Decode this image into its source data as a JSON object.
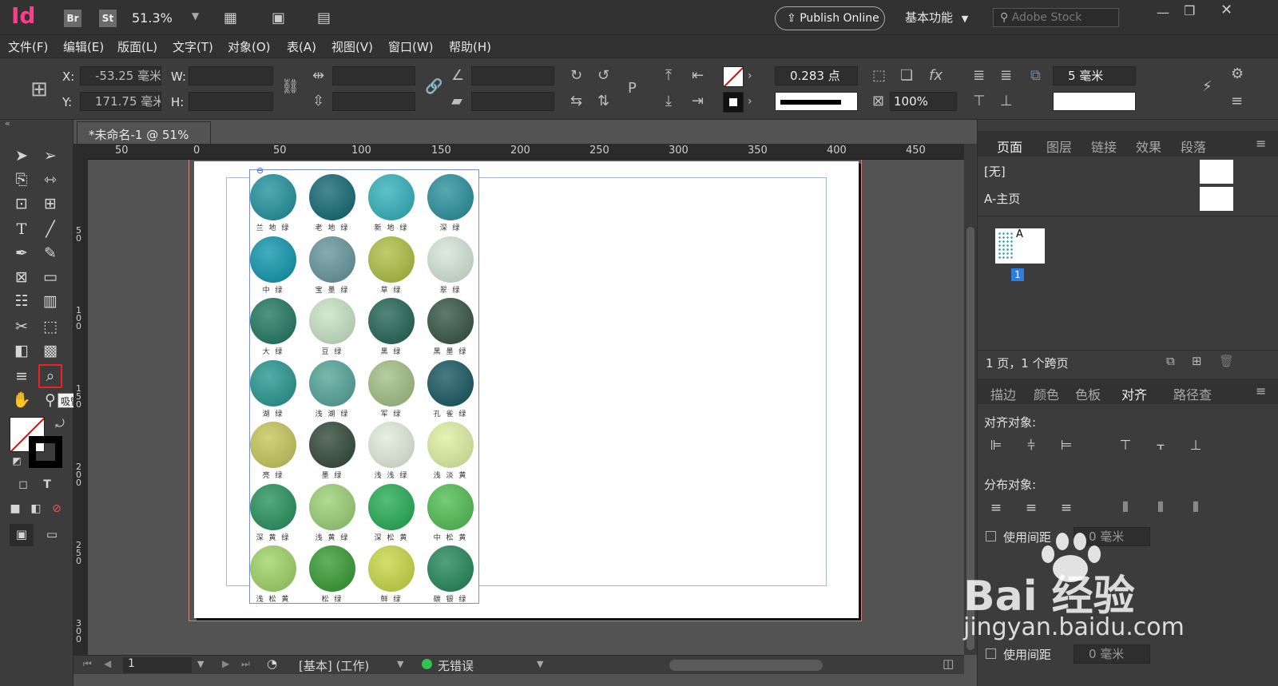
{
  "app": {
    "logo": "Id",
    "bridge_label": "Br",
    "stock_label": "St",
    "zoom": "51.3%",
    "publish_label": "Publish Online",
    "workspace": "基本功能",
    "search_placeholder": "Adobe Stock"
  },
  "menu": [
    "文件(F)",
    "编辑(E)",
    "版面(L)",
    "文字(T)",
    "对象(O)",
    "表(A)",
    "视图(V)",
    "窗口(W)",
    "帮助(H)"
  ],
  "control": {
    "x_label": "X:",
    "x_value": "-53.25 毫米",
    "y_label": "Y:",
    "y_value": "171.75 毫米",
    "w_label": "W:",
    "h_label": "H:",
    "stroke_weight": "0.283 点",
    "scale": "100%",
    "spacing": "5 毫米"
  },
  "document": {
    "tab_title": "*未命名-1 @ 51%",
    "ruler_top": [
      "50",
      "0",
      "50",
      "100",
      "150",
      "200",
      "250",
      "300",
      "350",
      "400",
      "450"
    ],
    "ruler_left": [
      "5\n0",
      "1\n0\n0",
      "1\n5\n0",
      "2\n0\n0",
      "2\n5\n0",
      "3\n0\n0"
    ]
  },
  "swatches": [
    {
      "name": "兰 地 绿",
      "color": "#2a96a1"
    },
    {
      "name": "老 地 绿",
      "color": "#1e6f7a"
    },
    {
      "name": "新 地 绿",
      "color": "#3bb4be"
    },
    {
      "name": "深 绿",
      "color": "#3295a0"
    },
    {
      "name": "中 绿",
      "color": "#1a9bb0"
    },
    {
      "name": "宝 墨 绿",
      "color": "#6c9aa0"
    },
    {
      "name": "草 绿",
      "color": "#b0c24a"
    },
    {
      "name": "翠 绿",
      "color": "#d6e6d8"
    },
    {
      "name": "大 绿",
      "color": "#2a7d67"
    },
    {
      "name": "豆 绿",
      "color": "#c9e3c6"
    },
    {
      "name": "黑 绿",
      "color": "#2c6b5c"
    },
    {
      "name": "黑 墨 绿",
      "color": "#3d5c4c"
    },
    {
      "name": "湖 绿",
      "color": "#2f9a94"
    },
    {
      "name": "浅 湖 绿",
      "color": "#5aa89d"
    },
    {
      "name": "军 绿",
      "color": "#a6c28a"
    },
    {
      "name": "孔 雀 绿",
      "color": "#205f66"
    },
    {
      "name": "亮 绿",
      "color": "#c8c862"
    },
    {
      "name": "墨 绿",
      "color": "#3b503f"
    },
    {
      "name": "浅 浅 绿",
      "color": "#e2ecdd"
    },
    {
      "name": "浅 淡 黄",
      "color": "#e0f0a6"
    },
    {
      "name": "深 黄 绿",
      "color": "#2f9663"
    },
    {
      "name": "浅 黄 绿",
      "color": "#9fd17a"
    },
    {
      "name": "深 松 黄",
      "color": "#2faf5c"
    },
    {
      "name": "中 松 黄",
      "color": "#58c05a"
    },
    {
      "name": "浅 松 黄",
      "color": "#a3d56c"
    },
    {
      "name": "松 绿",
      "color": "#3f9f3c"
    },
    {
      "name": "鲜 绿",
      "color": "#c9d94e"
    },
    {
      "name": "碳 银 绿",
      "color": "#2c8c60"
    }
  ],
  "tooltip": "吸管工具 (I)",
  "pages_panel": {
    "tabs": [
      "页面",
      "图层",
      "链接",
      "效果",
      "段落"
    ],
    "none_master": "[无]",
    "a_master": "A-主页",
    "page_master_letter": "A",
    "page_number": "1",
    "footer": "1 页，1 个跨页"
  },
  "align_panel": {
    "tabs": [
      "描边",
      "颜色",
      "色板",
      "对齐",
      "路径查"
    ],
    "align_objects": "对齐对象:",
    "distribute_objects": "分布对象:",
    "use_spacing": "使用间距",
    "spacing_value": "0 毫米"
  },
  "status": {
    "page": "1",
    "preflight_profile": "[基本] (工作)",
    "errors": "无错误"
  },
  "watermark": {
    "brand": "Bai 经验",
    "url": "jingyan.baidu.com"
  }
}
